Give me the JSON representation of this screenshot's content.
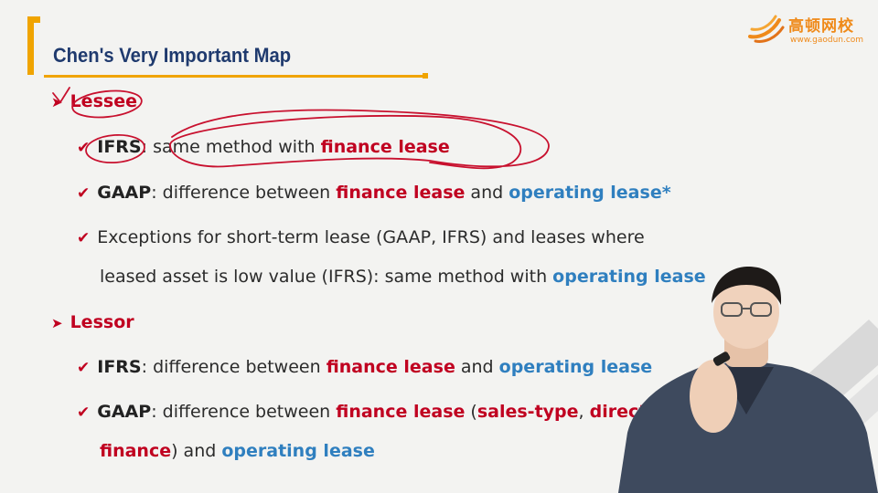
{
  "title": "Chen's Very Important Map",
  "logo": {
    "name": "高顿网校",
    "url": "www.gaodun.com"
  },
  "colors": {
    "accent": "#f0a400",
    "red": "#c00020",
    "blue": "#2f7fbf",
    "navy": "#1f3a6e",
    "logo": "#ef8a1a"
  },
  "lessee": {
    "heading": "Lessee",
    "ifrs": {
      "kw": "IFRS",
      "text": ": same method with ",
      "red": "finance lease"
    },
    "gaap": {
      "kw": "GAAP",
      "text1": ": difference between ",
      "red": "finance lease",
      "text2": " and ",
      "blue": "operating lease*"
    },
    "exceptions": {
      "line1": "Exceptions for short-term lease (GAAP, IFRS) and leases where",
      "line2": "leased asset is low value (IFRS): same method with ",
      "blue": "operating lease"
    }
  },
  "lessor": {
    "heading": "Lessor",
    "ifrs": {
      "kw": "IFRS",
      "text1": ": difference between ",
      "red": "finance lease",
      "text2": " and ",
      "blue": "operating lease"
    },
    "gaap": {
      "kw": "GAAP",
      "text1": ": difference between ",
      "red": "finance lease",
      "text2": " (",
      "red2": "sales-type",
      "text3": ", ",
      "red3": "direct",
      "red4": "finance",
      "text4": ") and ",
      "blue": "operating lease"
    }
  },
  "icons": {
    "bullet_level1": "arrow-bullet-icon",
    "bullet_level2": "check-icon"
  }
}
